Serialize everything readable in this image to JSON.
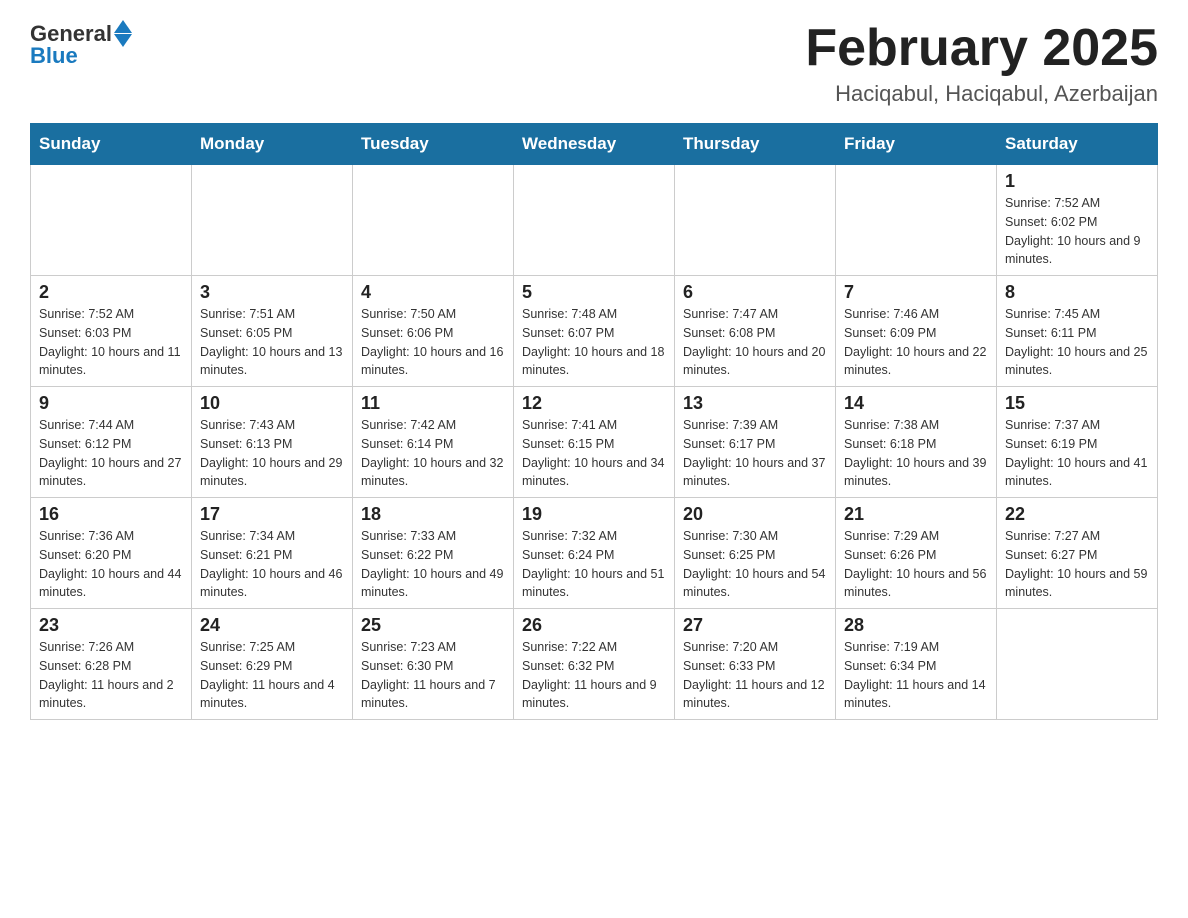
{
  "header": {
    "logo_general": "General",
    "logo_blue": "Blue",
    "title": "February 2025",
    "location": "Haciqabul, Haciqabul, Azerbaijan"
  },
  "days_of_week": [
    "Sunday",
    "Monday",
    "Tuesday",
    "Wednesday",
    "Thursday",
    "Friday",
    "Saturday"
  ],
  "weeks": [
    [
      {
        "day": "",
        "info": ""
      },
      {
        "day": "",
        "info": ""
      },
      {
        "day": "",
        "info": ""
      },
      {
        "day": "",
        "info": ""
      },
      {
        "day": "",
        "info": ""
      },
      {
        "day": "",
        "info": ""
      },
      {
        "day": "1",
        "info": "Sunrise: 7:52 AM\nSunset: 6:02 PM\nDaylight: 10 hours and 9 minutes."
      }
    ],
    [
      {
        "day": "2",
        "info": "Sunrise: 7:52 AM\nSunset: 6:03 PM\nDaylight: 10 hours and 11 minutes."
      },
      {
        "day": "3",
        "info": "Sunrise: 7:51 AM\nSunset: 6:05 PM\nDaylight: 10 hours and 13 minutes."
      },
      {
        "day": "4",
        "info": "Sunrise: 7:50 AM\nSunset: 6:06 PM\nDaylight: 10 hours and 16 minutes."
      },
      {
        "day": "5",
        "info": "Sunrise: 7:48 AM\nSunset: 6:07 PM\nDaylight: 10 hours and 18 minutes."
      },
      {
        "day": "6",
        "info": "Sunrise: 7:47 AM\nSunset: 6:08 PM\nDaylight: 10 hours and 20 minutes."
      },
      {
        "day": "7",
        "info": "Sunrise: 7:46 AM\nSunset: 6:09 PM\nDaylight: 10 hours and 22 minutes."
      },
      {
        "day": "8",
        "info": "Sunrise: 7:45 AM\nSunset: 6:11 PM\nDaylight: 10 hours and 25 minutes."
      }
    ],
    [
      {
        "day": "9",
        "info": "Sunrise: 7:44 AM\nSunset: 6:12 PM\nDaylight: 10 hours and 27 minutes."
      },
      {
        "day": "10",
        "info": "Sunrise: 7:43 AM\nSunset: 6:13 PM\nDaylight: 10 hours and 29 minutes."
      },
      {
        "day": "11",
        "info": "Sunrise: 7:42 AM\nSunset: 6:14 PM\nDaylight: 10 hours and 32 minutes."
      },
      {
        "day": "12",
        "info": "Sunrise: 7:41 AM\nSunset: 6:15 PM\nDaylight: 10 hours and 34 minutes."
      },
      {
        "day": "13",
        "info": "Sunrise: 7:39 AM\nSunset: 6:17 PM\nDaylight: 10 hours and 37 minutes."
      },
      {
        "day": "14",
        "info": "Sunrise: 7:38 AM\nSunset: 6:18 PM\nDaylight: 10 hours and 39 minutes."
      },
      {
        "day": "15",
        "info": "Sunrise: 7:37 AM\nSunset: 6:19 PM\nDaylight: 10 hours and 41 minutes."
      }
    ],
    [
      {
        "day": "16",
        "info": "Sunrise: 7:36 AM\nSunset: 6:20 PM\nDaylight: 10 hours and 44 minutes."
      },
      {
        "day": "17",
        "info": "Sunrise: 7:34 AM\nSunset: 6:21 PM\nDaylight: 10 hours and 46 minutes."
      },
      {
        "day": "18",
        "info": "Sunrise: 7:33 AM\nSunset: 6:22 PM\nDaylight: 10 hours and 49 minutes."
      },
      {
        "day": "19",
        "info": "Sunrise: 7:32 AM\nSunset: 6:24 PM\nDaylight: 10 hours and 51 minutes."
      },
      {
        "day": "20",
        "info": "Sunrise: 7:30 AM\nSunset: 6:25 PM\nDaylight: 10 hours and 54 minutes."
      },
      {
        "day": "21",
        "info": "Sunrise: 7:29 AM\nSunset: 6:26 PM\nDaylight: 10 hours and 56 minutes."
      },
      {
        "day": "22",
        "info": "Sunrise: 7:27 AM\nSunset: 6:27 PM\nDaylight: 10 hours and 59 minutes."
      }
    ],
    [
      {
        "day": "23",
        "info": "Sunrise: 7:26 AM\nSunset: 6:28 PM\nDaylight: 11 hours and 2 minutes."
      },
      {
        "day": "24",
        "info": "Sunrise: 7:25 AM\nSunset: 6:29 PM\nDaylight: 11 hours and 4 minutes."
      },
      {
        "day": "25",
        "info": "Sunrise: 7:23 AM\nSunset: 6:30 PM\nDaylight: 11 hours and 7 minutes."
      },
      {
        "day": "26",
        "info": "Sunrise: 7:22 AM\nSunset: 6:32 PM\nDaylight: 11 hours and 9 minutes."
      },
      {
        "day": "27",
        "info": "Sunrise: 7:20 AM\nSunset: 6:33 PM\nDaylight: 11 hours and 12 minutes."
      },
      {
        "day": "28",
        "info": "Sunrise: 7:19 AM\nSunset: 6:34 PM\nDaylight: 11 hours and 14 minutes."
      },
      {
        "day": "",
        "info": ""
      }
    ]
  ]
}
